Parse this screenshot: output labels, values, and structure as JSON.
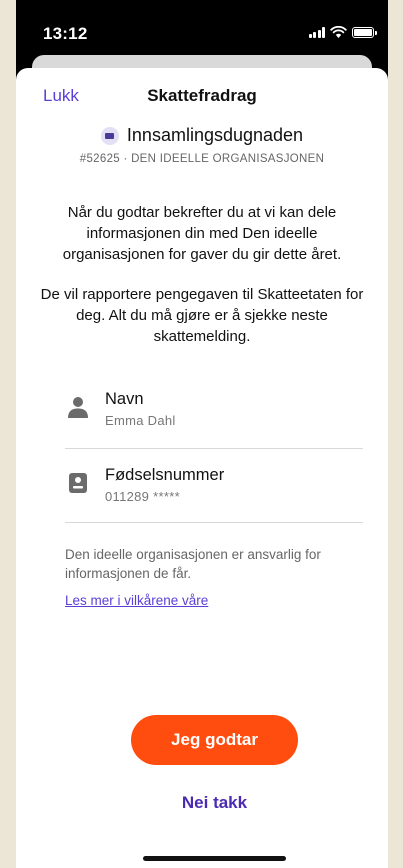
{
  "status_bar": {
    "time": "13:12"
  },
  "sheet": {
    "close_label": "Lukk",
    "title": "Skattefradrag"
  },
  "organization": {
    "name": "Innsamlingsdugnaden",
    "meta": "#52625 · DEN IDEELLE ORGANISASJONEN"
  },
  "text": {
    "paragraph_1": "Når du godtar bekrefter du at vi kan dele informasjonen din med Den ideelle organisasjonen for gaver du gir dette året.",
    "paragraph_2": "De vil rapportere pengegaven til Skatteetaten for deg. Alt du må gjøre er å sjekke neste skattemelding."
  },
  "fields": {
    "name": {
      "label": "Navn",
      "value": "Emma Dahl",
      "icon": "person-icon"
    },
    "birth_number": {
      "label": "Fødselsnummer",
      "value": "011289 *****",
      "icon": "id-card-icon"
    }
  },
  "disclaimer": {
    "text": "Den ideelle organisasjonen er ansvarlig for informasjonen de får.",
    "link_label": "Les mer i vilkårene våre"
  },
  "actions": {
    "accept_label": "Jeg godtar",
    "decline_label": "Nei takk"
  },
  "colors": {
    "accent": "#5b3fd6",
    "primary_button": "#ff4d0f",
    "page_background": "#ece6d6"
  }
}
